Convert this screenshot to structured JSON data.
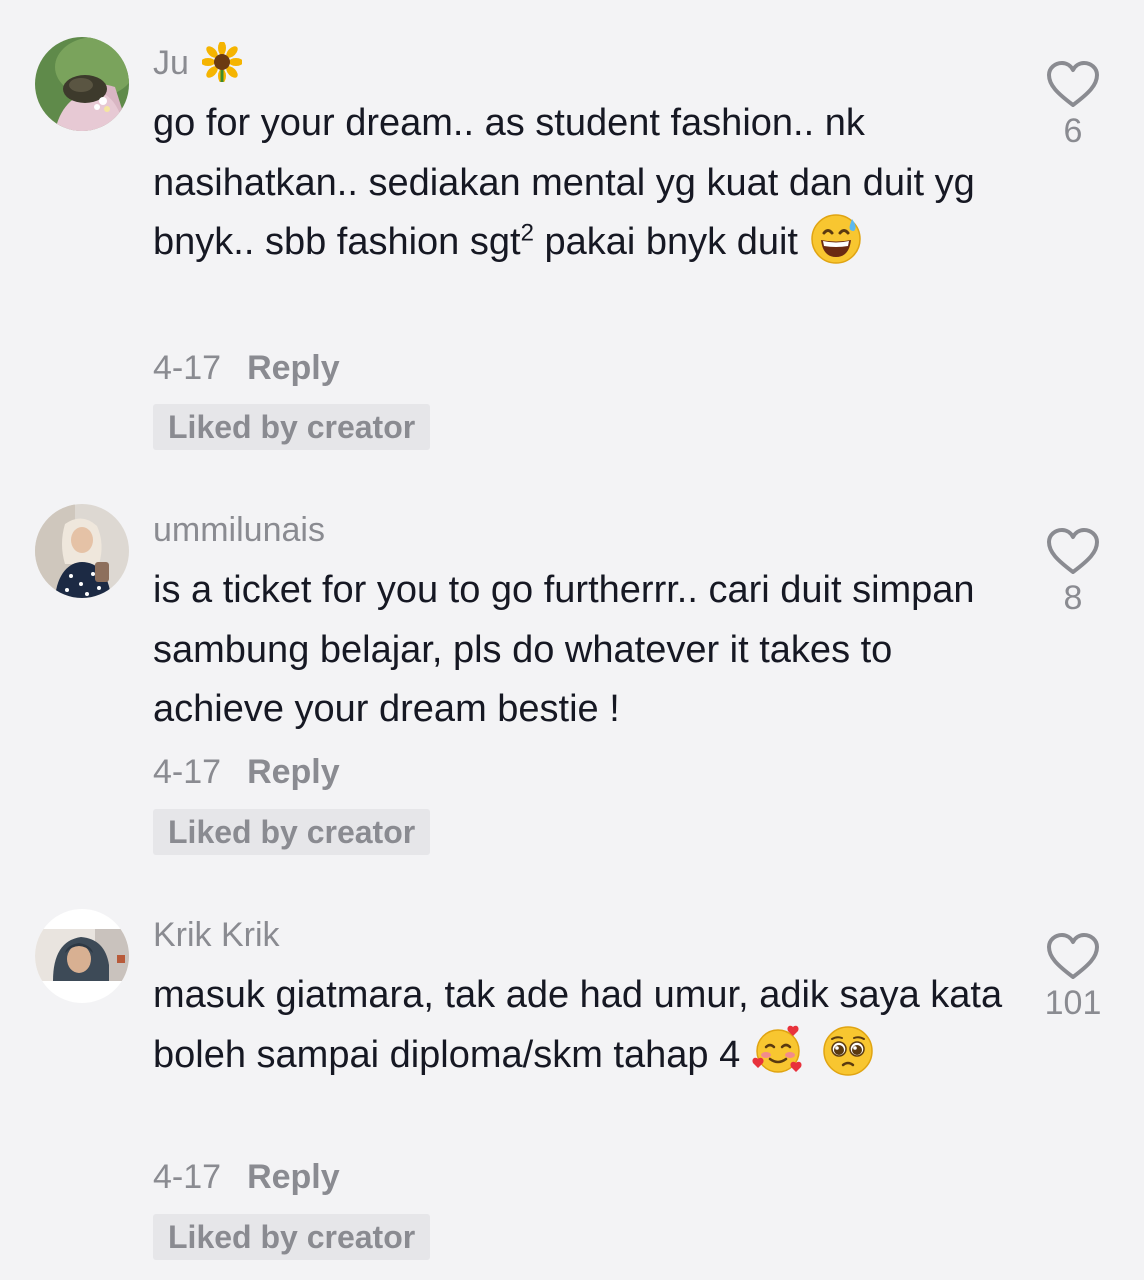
{
  "comments": [
    {
      "username": "Ju",
      "name_emoji": "sunflower-emoji",
      "text_parts": [
        "go for your dream.. as student fashion.. nk nasihatkan.. sediakan mental yg kuat dan duit yg bnyk.. sbb fashion sgt",
        "2",
        " pakai bnyk duit"
      ],
      "emojis": [
        "grinning-sweat-emoji"
      ],
      "date": "4-17",
      "reply_label": "Reply",
      "liked_label": "Liked by creator",
      "like_count": "6"
    },
    {
      "username": "ummilunais",
      "text": "is a ticket for you to go furtherrr.. cari duit simpan sambung belajar, pls do whatever it takes to achieve your dream bestie !",
      "date": "4-17",
      "reply_label": "Reply",
      "liked_label": "Liked by creator",
      "like_count": "8"
    },
    {
      "username": "Krik Krik",
      "text": "masuk giatmara, tak ade had umur, adik saya kata boleh sampai diploma/skm tahap 4",
      "emojis": [
        "smiling-hearts-emoji",
        "pleading-face-emoji"
      ],
      "date": "4-17",
      "reply_label": "Reply",
      "liked_label": "Liked by creator",
      "like_count": "101"
    }
  ],
  "colors": {
    "background": "#f3f3f5",
    "text": "#161823",
    "muted": "#8a8b91",
    "badge": "#e6e6e9"
  }
}
